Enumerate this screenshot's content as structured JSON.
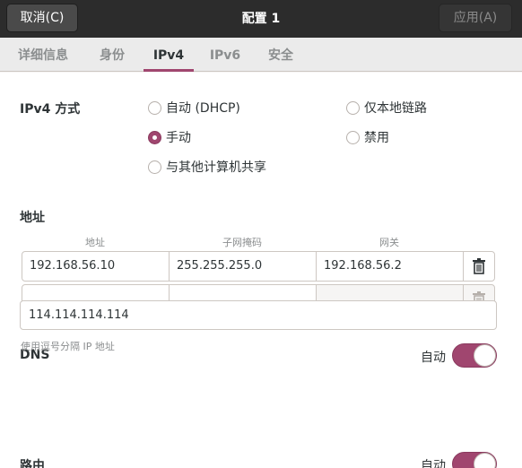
{
  "header": {
    "cancel_label": "取消(C)",
    "title": "配置 1",
    "apply_label": "应用(A)"
  },
  "tabs": [
    {
      "label": "详细信息"
    },
    {
      "label": "身份"
    },
    {
      "label": "IPv4",
      "active": true
    },
    {
      "label": "IPv6"
    },
    {
      "label": "安全"
    }
  ],
  "ipv4_method": {
    "label": "IPv4 方式",
    "options": [
      {
        "label": "自动 (DHCP)",
        "selected": false
      },
      {
        "label": "仅本地链路",
        "selected": false
      },
      {
        "label": "手动",
        "selected": true
      },
      {
        "label": "禁用",
        "selected": false
      },
      {
        "label": "与其他计算机共享",
        "selected": false
      }
    ]
  },
  "addresses": {
    "label": "地址",
    "columns": [
      "地址",
      "子网掩码",
      "网关"
    ],
    "rows": [
      [
        "192.168.56.10",
        "255.255.255.0",
        "192.168.56.2"
      ],
      [
        "",
        "",
        ""
      ]
    ]
  },
  "dns": {
    "label": "DNS",
    "auto_label": "自动",
    "auto_on": true,
    "value": "114.114.114.114",
    "hint": "使用逗号分隔 IP 地址"
  },
  "routes": {
    "label": "路由",
    "auto_label": "自动",
    "auto_on": true
  },
  "colors": {
    "accent": "#a0466f",
    "header_bg": "#2c2c2c"
  }
}
